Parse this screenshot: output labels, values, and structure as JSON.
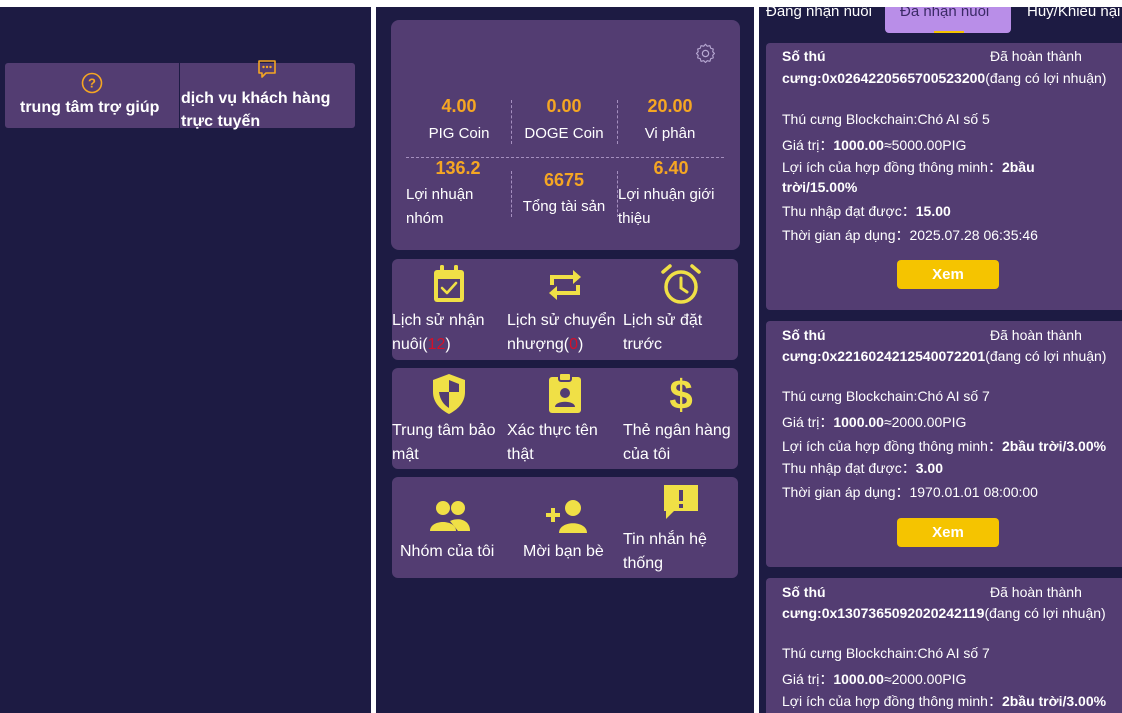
{
  "left": {
    "help_center": "trung tâm trợ giúp",
    "customer_service_line1": "dịch vụ khách hàng",
    "customer_service_line2": "trực tuyến"
  },
  "middle": {
    "stats": {
      "pig_coin_value": "4.00",
      "pig_coin_label": "PIG Coin",
      "doge_coin_value": "0.00",
      "doge_coin_label": "DOGE Coin",
      "vi_phan_value": "20.00",
      "vi_phan_label": "Vi phân",
      "group_profit_value": "136.2",
      "group_profit_label_1": "Lợi nhuận",
      "group_profit_label_2": "nhóm",
      "total_assets_value": "6675",
      "total_assets_label": "Tổng tài sản",
      "referral_profit_value": "6.40",
      "referral_profit_label_1": "Lợi nhuận giới",
      "referral_profit_label_2": "thiệu"
    },
    "menu1": {
      "adopt_history_1": "Lịch sử nhận",
      "adopt_history_2": "nuôi(",
      "adopt_history_count": "12",
      "adopt_history_close": ")",
      "transfer_history_1": "Lịch sử chuyển",
      "transfer_history_2": "nhượng(",
      "transfer_history_count": "0",
      "transfer_history_close": ")",
      "booking_history_1": "Lịch sử đặt",
      "booking_history_2": "trước"
    },
    "menu2": {
      "security_1": "Trung tâm bảo",
      "security_2": "mật",
      "verify_1": "Xác thực tên",
      "verify_2": "thật",
      "bank_1": "Thẻ ngân hàng",
      "bank_2": "của tôi"
    },
    "menu3": {
      "my_group": "Nhóm của tôi",
      "invite": "Mời bạn bè",
      "system_msg_1": "Tin nhắn hệ",
      "system_msg_2": "thống"
    }
  },
  "right": {
    "tabs": [
      "Đang nhận nuôi",
      "Đã nhận nuôi",
      "Hủy/Khiếu nại"
    ],
    "active_tab": "Đã nhận nuôi",
    "orders": [
      {
        "id_label": "Số thú",
        "status": "Đã hoàn thành",
        "id_value": "cưng:0x0264220565700523200",
        "id_note": "(đang có lợi nhuận)",
        "pet": "Thú cưng Blockchain:Chó AI số 5",
        "value_label": "Giá trị：",
        "value": "1000.00",
        "value_conv": "≈5000.00PIG",
        "benefit_label": "Lợi ích của hợp đồng thông minh：",
        "benefit_1": "2bầu",
        "benefit_2": "trời/15.00%",
        "income_label": "Thu nhập đạt được：",
        "income": "15.00",
        "time_label": "Thời gian áp dụng：",
        "time": "2025.07.28 06:35:46",
        "button": "Xem"
      },
      {
        "id_label": "Số thú",
        "status": "Đã hoàn thành",
        "id_value": "cưng:0x2216024212540072201",
        "id_note": "(đang có lợi nhuận)",
        "pet": "Thú cưng Blockchain:Chó AI số 7",
        "value_label": "Giá trị：",
        "value": "1000.00",
        "value_conv": "≈2000.00PIG",
        "benefit_label": "Lợi ích của hợp đồng thông minh：",
        "benefit_1": "2bầu trời/3.00%",
        "income_label": "Thu nhập đạt được：",
        "income": "3.00",
        "time_label": "Thời gian áp dụng：",
        "time": "1970.01.01 08:00:00",
        "button": "Xem"
      },
      {
        "id_label": "Số thú",
        "status": "Đã hoàn thành",
        "id_value": "cưng:0x1307365092020242119",
        "id_note": "(đang có lợi nhuận)",
        "pet": "Thú cưng Blockchain:Chó AI số 7",
        "value_label": "Giá trị：",
        "value": "1000.00",
        "value_conv": "≈2000.00PIG",
        "benefit_label": "Lợi ích của hợp đồng thông minh：",
        "benefit_1": "2bầu trời/3.00%"
      }
    ]
  },
  "colors": {
    "background": "#1d1b43",
    "card": "#533d72",
    "accent_orange": "#f5a623",
    "accent_yellow": "#f5c400",
    "tab_active": "#b98ee8",
    "icon_yellow": "#f0e046"
  }
}
